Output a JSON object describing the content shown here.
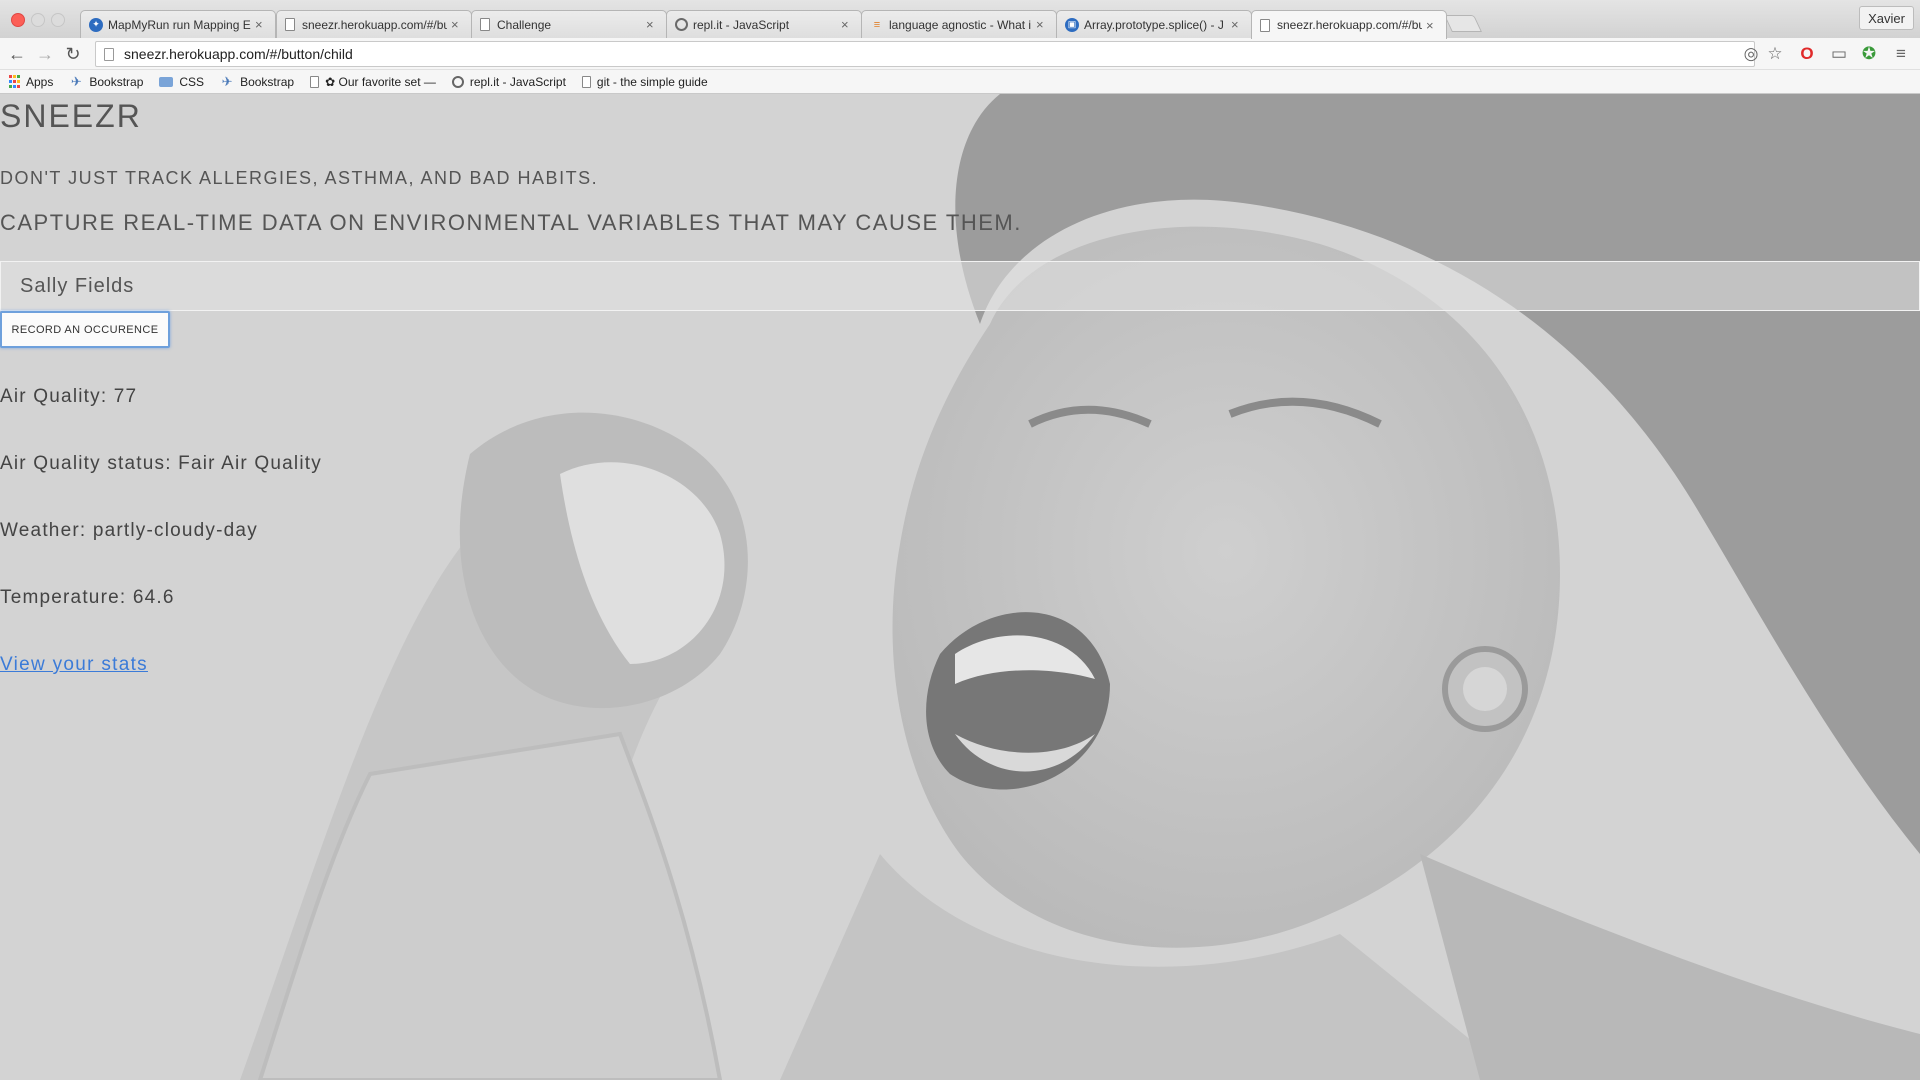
{
  "browser": {
    "tabs": [
      {
        "title": "MapMyRun run Mapping Ex",
        "icon": "mapmyrun-icon"
      },
      {
        "title": "sneezr.herokuapp.com/#/bu",
        "icon": "page-icon"
      },
      {
        "title": "Challenge",
        "icon": "page-icon"
      },
      {
        "title": "repl.it - JavaScript",
        "icon": "replit-icon"
      },
      {
        "title": "language agnostic - What i",
        "icon": "stackoverflow-icon"
      },
      {
        "title": "Array.prototype.splice() - J",
        "icon": "mdn-icon"
      },
      {
        "title": "sneezr.herokuapp.com/#/bu",
        "icon": "page-icon"
      }
    ],
    "profile_name": "Xavier",
    "url": "sneezr.herokuapp.com/#/button/child",
    "bookmarks": [
      {
        "label": "Apps",
        "icon": "apps-icon"
      },
      {
        "label": "Bookstrap",
        "icon": "bookmarklet-icon"
      },
      {
        "label": "CSS",
        "icon": "folder-icon"
      },
      {
        "label": "Bookstrap",
        "icon": "bookmarklet-icon"
      },
      {
        "label": "✿ Our favorite set —",
        "icon": "page-icon"
      },
      {
        "label": "repl.it - JavaScript",
        "icon": "replit-icon"
      },
      {
        "label": "git - the simple guide",
        "icon": "page-icon"
      }
    ]
  },
  "page": {
    "brand": "SNEEZR",
    "tagline_1": "DON'T JUST TRACK ALLERGIES, ASTHMA, AND BAD HABITS.",
    "tagline_2": "CAPTURE REAL-TIME DATA ON ENVIRONMENTAL VARIABLES THAT MAY CAUSE THEM.",
    "name_value": "Sally Fields",
    "record_button": "RECORD AN OCCURENCE",
    "air_quality": "Air Quality: 77",
    "air_quality_status": "Air Quality status: Fair Air Quality",
    "weather": "Weather: partly-cloudy-day",
    "temperature": "Temperature: 64.6",
    "stats_link": "View your stats"
  },
  "colors": {
    "accent_link": "#3b7bd8",
    "button_focus": "#6ea0dc",
    "text": "#555555"
  }
}
